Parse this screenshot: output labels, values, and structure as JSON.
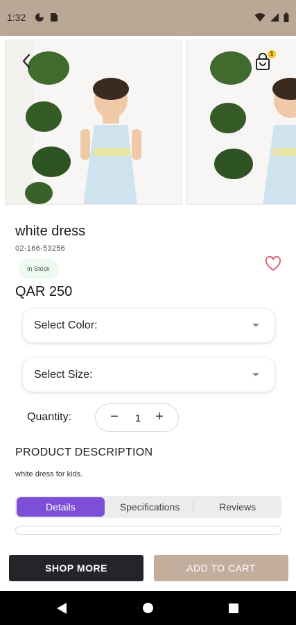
{
  "status_bar": {
    "time": "1:32"
  },
  "header": {
    "cart_count": "1"
  },
  "product": {
    "title": "white dress",
    "sku": "02-166-53256",
    "stock_status": "In Stock",
    "price": "QAR 250"
  },
  "options": {
    "color_placeholder": "Select Color:",
    "size_placeholder": "Select Size:"
  },
  "quantity": {
    "label": "Quantity:",
    "value": "1",
    "minus": "−",
    "plus": "+"
  },
  "description": {
    "heading": "PRODUCT DESCRIPTION",
    "text": "white dress for kids."
  },
  "tabs": [
    {
      "label": "Details",
      "active": true
    },
    {
      "label": "Specifications",
      "active": false
    },
    {
      "label": "Reviews",
      "active": false
    }
  ],
  "actions": {
    "shop_more": "SHOP MORE",
    "add_to_cart": "ADD TO CART"
  },
  "colors": {
    "status_bar": "#bba796",
    "accent_tab": "#7c4fd6",
    "shop_more_bg": "#23252b",
    "add_to_cart_bg": "#c3ad9c",
    "stock_badge_bg": "#eef9f1",
    "wishlist_heart": "#e0566c"
  },
  "icons": {
    "status": [
      "data-saver-icon",
      "sim-card-icon",
      "wifi-icon",
      "cellular-signal-icon",
      "battery-icon"
    ],
    "header": [
      "back-arrow-icon",
      "shopping-bag-icon"
    ],
    "product": [
      "heart-outline-icon"
    ]
  }
}
